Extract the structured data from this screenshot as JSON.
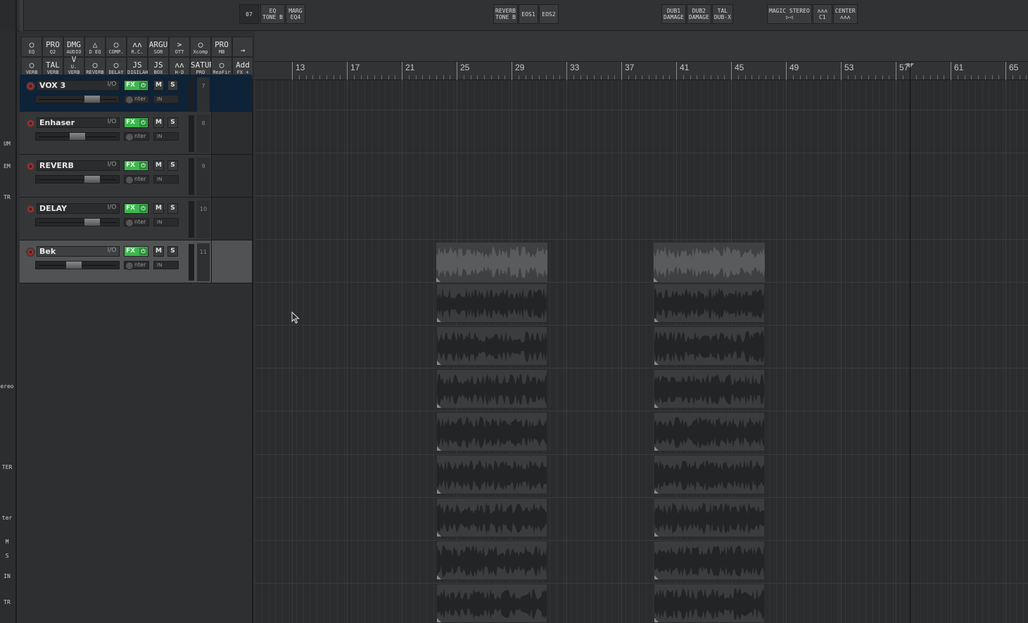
{
  "app": "REAPER",
  "top_plugins": [
    {
      "group": "first",
      "buttons": [
        {
          "l1": "",
          "l2": "07"
        }
      ]
    },
    {
      "group": "eq",
      "buttons": [
        {
          "l1": "EQ",
          "l2": "TONE B"
        },
        {
          "l1": "MARG",
          "l2": "EQ4"
        }
      ]
    },
    {
      "group": "reverb",
      "buttons": [
        {
          "l1": "REVERB",
          "l2": "TONE B"
        },
        {
          "l1": "EOS1",
          "l2": ""
        },
        {
          "l1": "EOS2",
          "l2": ""
        }
      ]
    },
    {
      "group": "dub",
      "buttons": [
        {
          "l1": "DUB1",
          "l2": "DAMAGE"
        },
        {
          "l1": "DUB2",
          "l2": "DAMAGE"
        },
        {
          "l1": "TAL",
          "l2": "DUB-X"
        }
      ]
    },
    {
      "group": "stereo",
      "buttons": [
        {
          "l1": "MAGIC STEREO",
          "l2": "▷◁"
        },
        {
          "l1": "ᴧᴧᴧ",
          "l2": "C1"
        },
        {
          "l1": "CENTER",
          "l2": "ᴧᴧᴧ"
        }
      ]
    }
  ],
  "fx_toolbar": [
    {
      "icon": "◯",
      "label": "EQ"
    },
    {
      "icon": "PRO",
      "label": "Q2"
    },
    {
      "icon": "DMG",
      "label": "AUDIO"
    },
    {
      "icon": "△",
      "label": "D EQ"
    },
    {
      "icon": "◯",
      "label": "COMP."
    },
    {
      "icon": "ᴧᴧ",
      "label": "R.C."
    },
    {
      "icon": "ARGU",
      "label": "SOR"
    },
    {
      "icon": ">",
      "label": "OTT"
    },
    {
      "icon": "◯",
      "label": "Xcomp"
    },
    {
      "icon": "PRO",
      "label": "MB"
    },
    {
      "icon": "→",
      "label": ""
    },
    {
      "icon": "◯",
      "label": "VERB"
    },
    {
      "icon": "TAL",
      "label": "VERB"
    },
    {
      "icon": "V",
      "label": "U. VERB"
    },
    {
      "icon": "◯",
      "label": "REVERB"
    },
    {
      "icon": "◯",
      "label": "DELAY"
    },
    {
      "icon": "JS",
      "label": "DIGILAH"
    },
    {
      "icon": "JS",
      "label": "BOX"
    },
    {
      "icon": "ᴧᴧ",
      "label": "H-D"
    },
    {
      "icon": "SATURN",
      "label": "PRO"
    },
    {
      "icon": "◯",
      "label": "ReaFir"
    },
    {
      "icon": "Add",
      "label": "FX +"
    }
  ],
  "left_edge": [
    {
      "text": "UM",
      "top": "200"
    },
    {
      "text": "EM",
      "top": "232"
    },
    {
      "text": "TR",
      "top": "276"
    },
    {
      "text": "ereo",
      "top": "545"
    },
    {
      "text": "TER",
      "top": "660"
    },
    {
      "text": "ter",
      "top": "732"
    },
    {
      "text": "M",
      "top": "766"
    },
    {
      "text": "S",
      "top": "786"
    },
    {
      "text": "IN",
      "top": "815"
    },
    {
      "text": "TR",
      "top": "852"
    }
  ],
  "tracks": [
    {
      "name": "VOX 3",
      "io": "I/O",
      "fx": "FX",
      "power": "⏻",
      "mute": "M",
      "solo": "S",
      "pan": "nter",
      "input": "IN",
      "number": "7",
      "fader": 0.72,
      "style": "sel"
    },
    {
      "name": "Enhaser",
      "io": "I/O",
      "fx": "FX",
      "power": "⏻",
      "mute": "M",
      "solo": "S",
      "pan": "nter",
      "input": "IN",
      "number": "8",
      "fader": 0.5,
      "style": ""
    },
    {
      "name": "REVERB",
      "io": "I/O",
      "fx": "FX",
      "power": "⏻",
      "mute": "M",
      "solo": "S",
      "pan": "nter",
      "input": "IN",
      "number": "9",
      "fader": 0.72,
      "style": ""
    },
    {
      "name": "DELAY",
      "io": "I/O",
      "fx": "FX",
      "power": "⏻",
      "mute": "M",
      "solo": "S",
      "pan": "nter",
      "input": "IN",
      "number": "10",
      "fader": 0.72,
      "style": ""
    },
    {
      "name": "Bek",
      "io": "I/O",
      "fx": "FX",
      "power": "⏻",
      "mute": "M",
      "solo": "S",
      "pan": "nter",
      "input": "IN",
      "number": "11",
      "fader": 0.45,
      "style": "hl"
    }
  ],
  "ruler": {
    "marks": [
      "13",
      "17",
      "21",
      "25",
      "29",
      "33",
      "37",
      "41",
      "45",
      "49",
      "53",
      "57",
      "61",
      "65"
    ]
  },
  "colors": {
    "fx_green": "#3cb84e",
    "selected_track": "#0e2238",
    "record_red": "#a83232"
  }
}
